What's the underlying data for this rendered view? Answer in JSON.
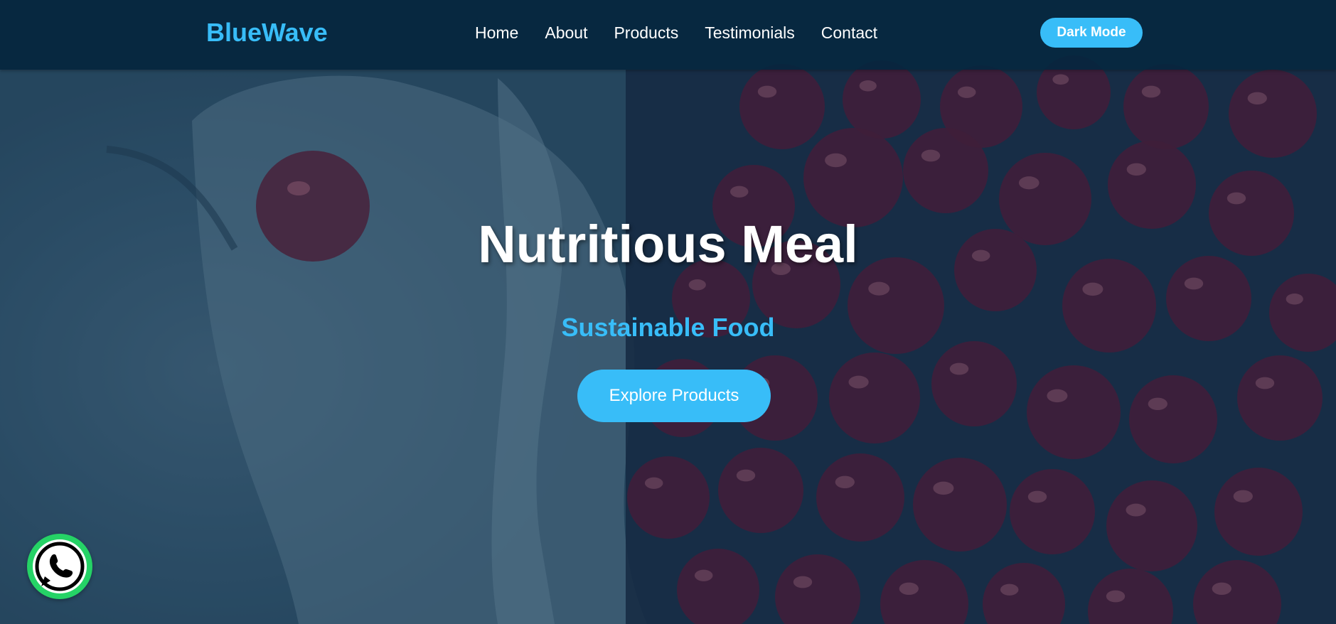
{
  "brand": {
    "name": "BlueWave"
  },
  "nav": {
    "items": [
      {
        "label": "Home"
      },
      {
        "label": "About"
      },
      {
        "label": "Products"
      },
      {
        "label": "Testimonials"
      },
      {
        "label": "Contact"
      }
    ],
    "dark_mode_label": "Dark Mode"
  },
  "hero": {
    "title": "Nutritious Meal",
    "subtitle": "Sustainable Food",
    "cta_label": "Explore Products",
    "background": "cherries-in-cloth-bag-photo"
  },
  "floating": {
    "whatsapp_icon": "whatsapp-icon"
  },
  "colors": {
    "accent": "#38bdf8",
    "navbar": "#05263e",
    "whatsapp": "#25d366",
    "text": "#ffffff"
  }
}
